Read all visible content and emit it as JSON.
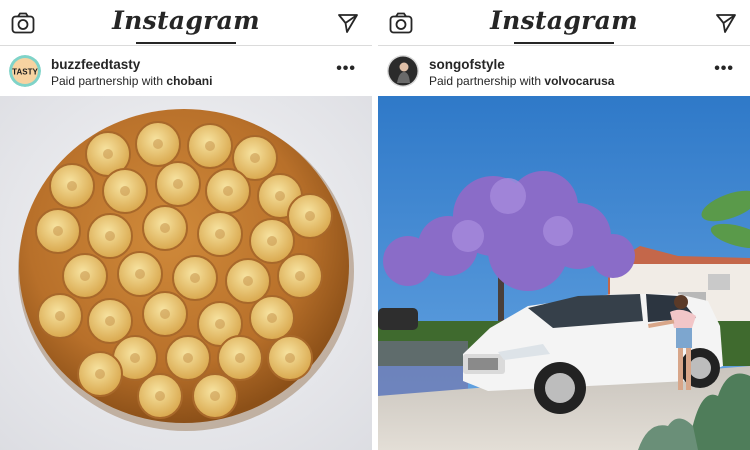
{
  "app": {
    "brand": "Instagram"
  },
  "posts": [
    {
      "username": "buzzfeedtasty",
      "paid_prefix": "Paid partnership with ",
      "partner": "chobani",
      "avatar_text": "TASTY",
      "more": "•••"
    },
    {
      "username": "songofstyle",
      "paid_prefix": "Paid partnership with ",
      "partner": "volvocarusa",
      "more": "•••"
    }
  ],
  "icons": {
    "camera": "camera-icon",
    "direct": "paper-plane-icon",
    "more": "more-options-icon"
  }
}
